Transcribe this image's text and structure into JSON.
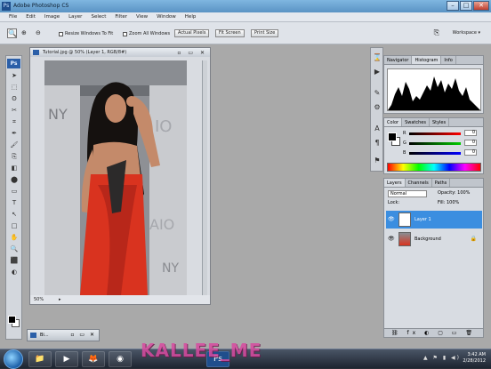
{
  "window": {
    "app_icon": "Ps",
    "title": "Adobe Photoshop CS",
    "controls": [
      "–",
      "□",
      "✕"
    ]
  },
  "menu": [
    "File",
    "Edit",
    "Image",
    "Layer",
    "Select",
    "Filter",
    "View",
    "Window",
    "Help"
  ],
  "options_bar": {
    "tool_icon": "zoom-icon",
    "tool_glyph": "🔍",
    "resize_windows_label": "Resize Windows To Fit",
    "zoom_all_label": "Zoom All Windows",
    "actual_pixels_label": "Actual Pixels",
    "fit_screen_label": "Fit Screen",
    "print_size_label": "Print Size",
    "workspace_label": "Workspace ▾"
  },
  "toolbox": {
    "logo": "Ps",
    "tools": [
      "➤",
      "⬚",
      "ʘ",
      "✂",
      "⌗",
      "✒",
      "🖌",
      "⎘",
      "◧",
      "⬤",
      "▭",
      "T",
      "↖",
      "□",
      "✋",
      "🔍",
      "⬛",
      "◐"
    ],
    "foreground": "#000000",
    "background": "#ffffff"
  },
  "document": {
    "title": "Tutorial.jpg @ 50% (Layer 1, RGB/8#)",
    "zoom": "50%",
    "status_arrow": "▸",
    "minimized_title": "Bi...",
    "minimized_controls": "▫ ▭ ✕"
  },
  "panels": {
    "histogram_tabs": [
      "Navigator",
      "Histogram",
      "Info"
    ],
    "color_tabs": [
      "Color",
      "Swatches",
      "Styles"
    ],
    "color_sliders": [
      {
        "label": "R",
        "value": "0",
        "color": "#c81818"
      },
      {
        "label": "G",
        "value": "0",
        "color": "#18a018"
      },
      {
        "label": "B",
        "value": "0",
        "color": "#1830c8"
      }
    ],
    "layers_tabs": [
      "Layers",
      "Channels",
      "Paths"
    ],
    "blend_mode": "Normal",
    "opacity": "Opacity: 100%",
    "lock": "Lock:",
    "fill": "Fill: 100%",
    "layers": [
      {
        "name": "Layer 1",
        "selected": true,
        "color": "#3b8ee0"
      },
      {
        "name": "Background",
        "selected": false,
        "color": "#d8dce2",
        "locked": true
      }
    ],
    "footer_icons": "⛓ fx ◐ ▢ ▭ 🗑"
  },
  "taskbar": {
    "apps": [
      "📁",
      "▶",
      "🦊",
      "◉",
      "Ps"
    ],
    "watermark": "KALLEE_ME",
    "tray_icons": "▲ ⚑ ▮ ◀)",
    "time": "3:42 AM",
    "date": "2/28/2012"
  }
}
